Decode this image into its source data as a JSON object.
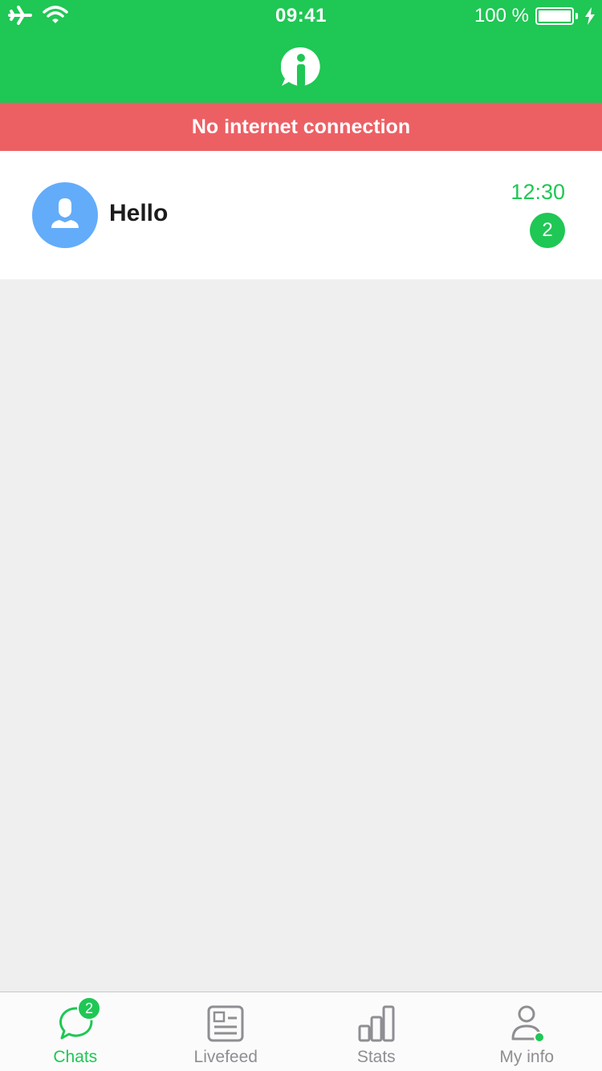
{
  "status_bar": {
    "time": "09:41",
    "battery_percent": "100 %",
    "icons": [
      "airplane-icon",
      "wifi-icon",
      "battery-icon",
      "charging-bolt-icon"
    ]
  },
  "header": {
    "logo_icon": "info-chat-logo-icon"
  },
  "banner": {
    "text": "No internet connection",
    "color": "#ec6064"
  },
  "chats": [
    {
      "name": "Hello",
      "time": "12:30",
      "unread": "2",
      "avatar_icon": "person-icon"
    }
  ],
  "tab_bar": {
    "tabs": [
      {
        "label": "Chats",
        "icon": "chat-bubble-icon",
        "active": true,
        "badge": "2"
      },
      {
        "label": "Livefeed",
        "icon": "newspaper-icon",
        "active": false
      },
      {
        "label": "Stats",
        "icon": "bar-chart-icon",
        "active": false
      },
      {
        "label": "My info",
        "icon": "person-online-icon",
        "active": false
      }
    ]
  },
  "colors": {
    "accent": "#1fc754",
    "alert": "#ec6064",
    "avatar": "#63acfa",
    "inactive": "#8e8e93"
  }
}
